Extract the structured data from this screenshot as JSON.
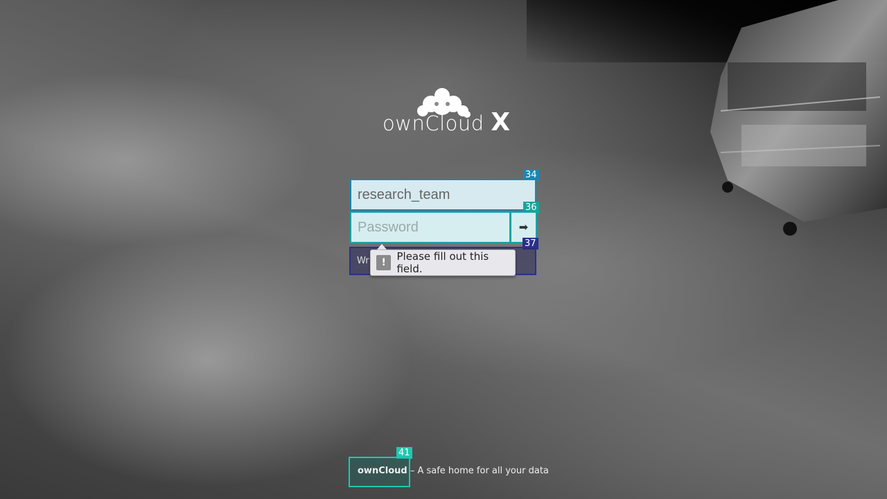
{
  "brand": {
    "name": "ownCloud",
    "suffix": "X"
  },
  "login": {
    "username_value": "research_team",
    "password_placeholder": "Password",
    "submit_icon": "arrow-right-icon",
    "error_text_partial": "Wr",
    "validation_tooltip": "Please fill out this field."
  },
  "badges": {
    "username": "34",
    "password": "36",
    "error": "37",
    "footer": "41"
  },
  "footer": {
    "link": "ownCloud",
    "tagline": " – A safe home for all your data"
  },
  "colors": {
    "badge_blue": "#1b87b0",
    "badge_teal": "#1aa39a",
    "badge_indigo": "#2b2f8c",
    "badge_green": "#1ec8b0"
  }
}
